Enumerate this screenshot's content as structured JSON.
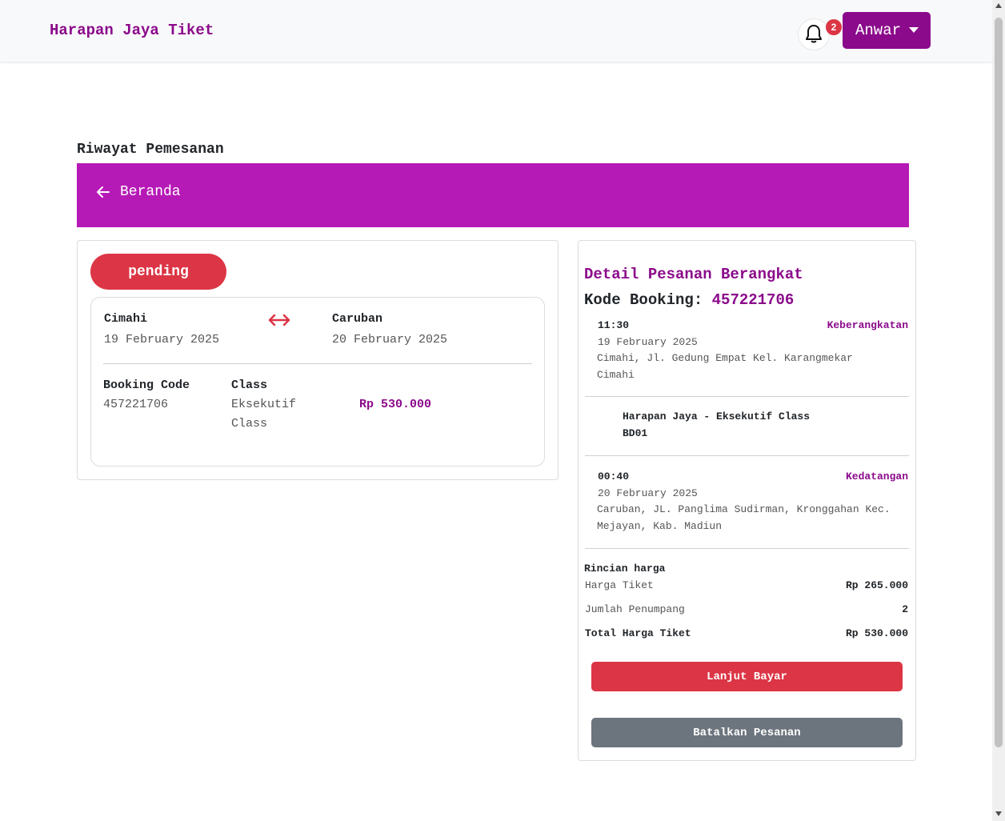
{
  "navbar": {
    "brand": "Harapan Jaya Tiket",
    "notification_count": "2",
    "user_name": "Anwar",
    "bell_icon": "bell-icon",
    "caret_icon": "caret-down-icon"
  },
  "page": {
    "title": "Riwayat Pemesanan",
    "back_label": "Beranda",
    "back_icon": "arrow-left-icon"
  },
  "order_card": {
    "status": "pending",
    "origin_city": "Cimahi",
    "origin_date": "19 February 2025",
    "destination_city": "Caruban",
    "destination_date": "20 February 2025",
    "route_icon": "double-arrow-icon",
    "booking_code_label": "Booking Code",
    "booking_code": "457221706",
    "class_label": "Class",
    "class_value_line1": "Eksekutif",
    "class_value_line2": "Class",
    "price": "Rp 530.000"
  },
  "detail": {
    "title": "Detail Pesanan Berangkat",
    "kode_label": "Kode Booking:",
    "kode_value": "457221706",
    "departure": {
      "time": "11:30",
      "tag": "Keberangkatan",
      "date": "19 February 2025",
      "address_line1": "Cimahi, Jl. Gedung Empat Kel. Karangmekar",
      "address_line2": "Cimahi"
    },
    "bus": {
      "name": "Harapan Jaya - Eksekutif Class",
      "code": "BD01"
    },
    "arrival": {
      "time": "00:40",
      "tag": "Kedatangan",
      "date": "20 February 2025",
      "address_line1": "Caruban, JL. Panglima Sudirman, Kronggahan Kec.",
      "address_line2": "Mejayan, Kab. Madiun"
    },
    "price_breakdown": {
      "heading": "Rincian harga",
      "ticket_label": "Harga Tiket",
      "ticket_value": "Rp 265.000",
      "passenger_label": "Jumlah Penumpang",
      "passenger_value": "2",
      "total_label": "Total Harga Tiket",
      "total_value": "Rp 530.000"
    },
    "pay_button": "Lanjut Bayar",
    "cancel_button": "Batalkan Pesanan"
  },
  "colors": {
    "brand": "#8b0a8b",
    "banner": "#b61ab6",
    "danger": "#dc3545",
    "secondary": "#6c757d"
  }
}
